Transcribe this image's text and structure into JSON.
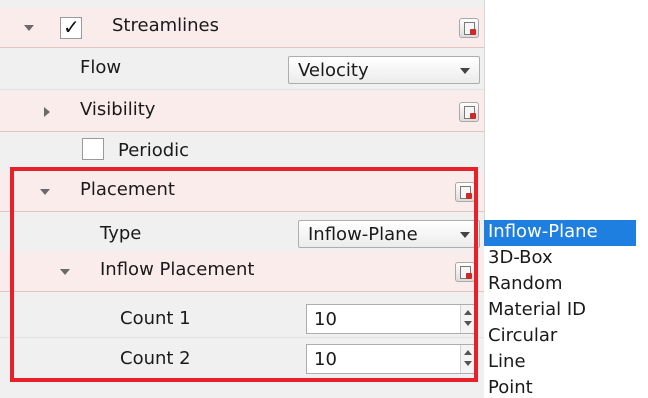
{
  "panel": {
    "streamlines": {
      "label": "Streamlines",
      "checked": true
    },
    "flow": {
      "label": "Flow",
      "value": "Velocity"
    },
    "visibility": {
      "label": "Visibility"
    },
    "periodic": {
      "label": "Periodic",
      "checked": false
    },
    "placement": {
      "label": "Placement"
    },
    "type": {
      "label": "Type",
      "value": "Inflow-Plane"
    },
    "inflow_placement": {
      "label": "Inflow Placement"
    },
    "count1": {
      "label": "Count 1",
      "value": "10"
    },
    "count2": {
      "label": "Count 2",
      "value": "10"
    }
  },
  "type_dropdown": {
    "options": [
      "Inflow-Plane",
      "3D-Box",
      "Random",
      "Material ID",
      "Circular",
      "Line",
      "Point"
    ],
    "selected": "Inflow-Plane"
  },
  "colors": {
    "highlight_border": "#e8202a",
    "selection": "#1e7fe0",
    "header_row": "#fbecec"
  },
  "icons": [
    "expand-triangle-icon",
    "collapse-triangle-icon",
    "reset-parameter-icon",
    "checkmark-icon",
    "spinner-arrows-icon"
  ]
}
